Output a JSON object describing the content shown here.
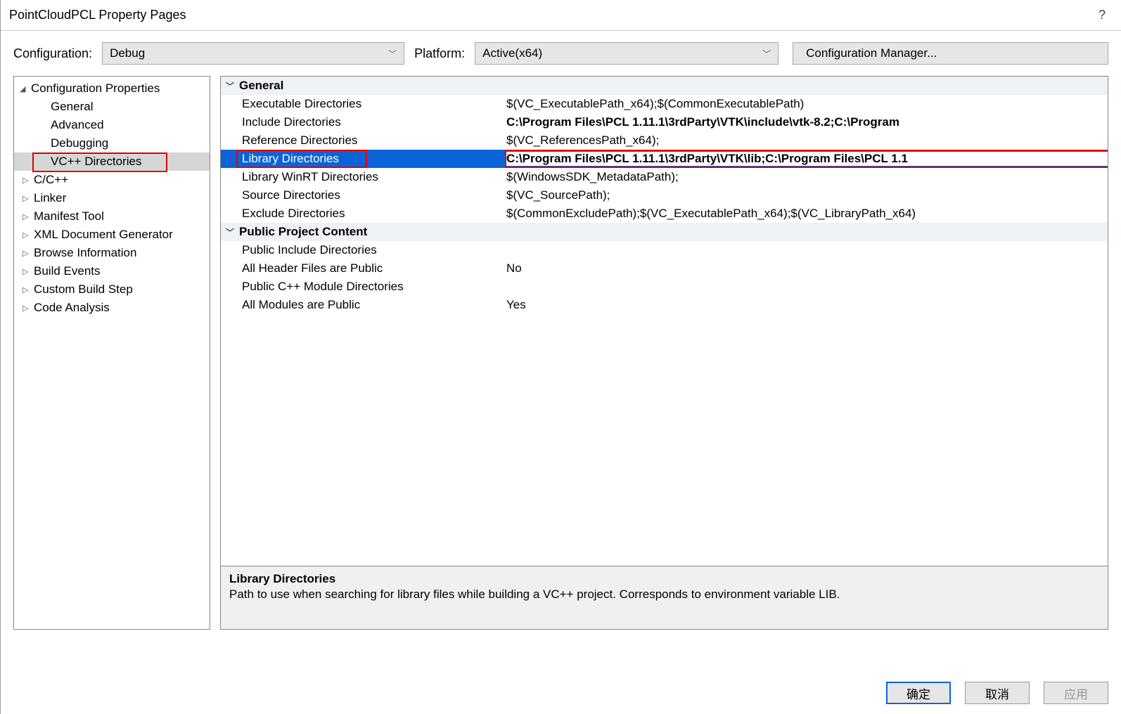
{
  "window": {
    "title": "PointCloudPCL Property Pages",
    "help": "?"
  },
  "config": {
    "label": "Configuration:",
    "value": "Debug",
    "platform_label": "Platform:",
    "platform_value": "Active(x64)",
    "manager_btn": "Configuration Manager..."
  },
  "tree": {
    "root": "Configuration Properties",
    "items": [
      {
        "label": "General",
        "arrow": ""
      },
      {
        "label": "Advanced",
        "arrow": ""
      },
      {
        "label": "Debugging",
        "arrow": ""
      },
      {
        "label": "VC++ Directories",
        "arrow": "",
        "selected": true
      },
      {
        "label": "C/C++",
        "arrow": "▷"
      },
      {
        "label": "Linker",
        "arrow": "▷"
      },
      {
        "label": "Manifest Tool",
        "arrow": "▷"
      },
      {
        "label": "XML Document Generator",
        "arrow": "▷"
      },
      {
        "label": "Browse Information",
        "arrow": "▷"
      },
      {
        "label": "Build Events",
        "arrow": "▷"
      },
      {
        "label": "Custom Build Step",
        "arrow": "▷"
      },
      {
        "label": "Code Analysis",
        "arrow": "▷"
      }
    ]
  },
  "grid": {
    "groups": [
      {
        "name": "General",
        "rows": [
          {
            "label": "Executable Directories",
            "value": "$(VC_ExecutablePath_x64);$(CommonExecutablePath)"
          },
          {
            "label": "Include Directories",
            "value": "C:\\Program Files\\PCL 1.11.1\\3rdParty\\VTK\\include\\vtk-8.2;C:\\Program",
            "bold": true
          },
          {
            "label": "Reference Directories",
            "value": "$(VC_ReferencesPath_x64);"
          },
          {
            "label": "Library Directories",
            "value": "C:\\Program Files\\PCL 1.11.1\\3rdParty\\VTK\\lib;C:\\Program Files\\PCL 1.1",
            "selected": true,
            "bold": true
          },
          {
            "label": "Library WinRT Directories",
            "value": "$(WindowsSDK_MetadataPath);"
          },
          {
            "label": "Source Directories",
            "value": "$(VC_SourcePath);"
          },
          {
            "label": "Exclude Directories",
            "value": "$(CommonExcludePath);$(VC_ExecutablePath_x64);$(VC_LibraryPath_x64)"
          }
        ]
      },
      {
        "name": "Public Project Content",
        "rows": [
          {
            "label": "Public Include Directories",
            "value": ""
          },
          {
            "label": "All Header Files are Public",
            "value": "No"
          },
          {
            "label": "Public C++ Module Directories",
            "value": ""
          },
          {
            "label": "All Modules are Public",
            "value": "Yes"
          }
        ]
      }
    ]
  },
  "desc": {
    "title": "Library Directories",
    "text": "Path to use when searching for library files while building a VC++ project.  Corresponds to environment variable LIB."
  },
  "buttons": {
    "ok": "确定",
    "cancel": "取消",
    "apply": "应用"
  }
}
